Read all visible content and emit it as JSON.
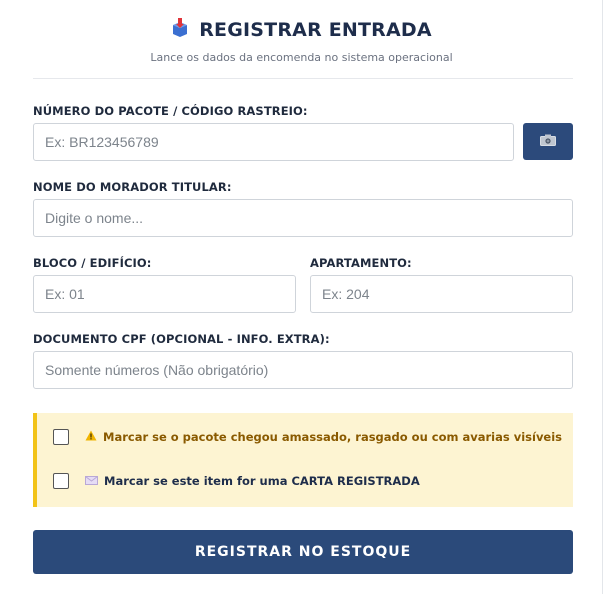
{
  "header": {
    "title": "REGISTRAR ENTRADA",
    "subtitle": "Lance os dados da encomenda no sistema operacional",
    "icon": "package-icon"
  },
  "form": {
    "tracking": {
      "label": "NÚMERO DO PACOTE / CÓDIGO RASTREIO:",
      "placeholder": "Ex: BR123456789",
      "value": "",
      "scan_button_icon": "camera-icon"
    },
    "resident": {
      "label": "NOME DO MORADOR TITULAR:",
      "placeholder": "Digite o nome...",
      "value": ""
    },
    "block": {
      "label": "BLOCO / EDIFÍCIO:",
      "placeholder": "Ex: 01",
      "value": ""
    },
    "apartment": {
      "label": "APARTAMENTO:",
      "placeholder": "Ex: 204",
      "value": ""
    },
    "cpf": {
      "label": "DOCUMENTO CPF (OPCIONAL - INFO. EXTRA):",
      "placeholder": "Somente números (Não obrigatório)",
      "value": ""
    }
  },
  "options": {
    "damaged": {
      "label": "Marcar se o pacote chegou amassado, rasgado ou com avarias visíveis",
      "checked": false,
      "icon": "warning-icon",
      "color": "#8a5a00"
    },
    "registered_letter": {
      "label": "Marcar se este item for uma CARTA REGISTRADA",
      "checked": false,
      "icon": "envelope-icon",
      "color": "#1e2d4b"
    }
  },
  "submit": {
    "label": "REGISTRAR NO ESTOQUE"
  },
  "colors": {
    "primary": "#2b4a7a",
    "alert_bg": "#fdf4d2",
    "alert_border": "#f2c318"
  }
}
